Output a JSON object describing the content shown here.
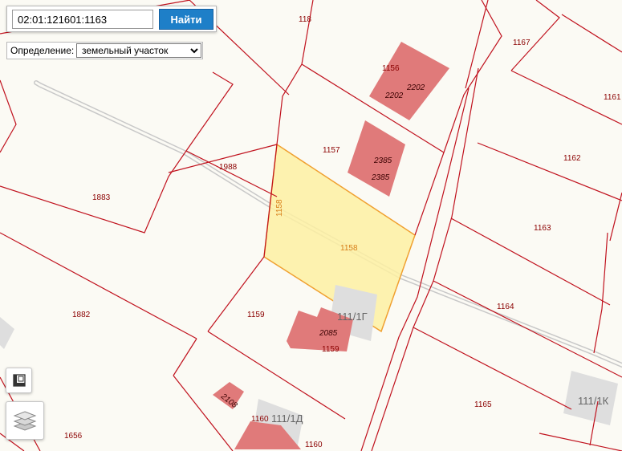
{
  "search": {
    "value": "02:01:121601:1163",
    "button_label": "Найти"
  },
  "definition": {
    "label": "Определение:",
    "selected": "земельный участок"
  },
  "map": {
    "watermark_text": "",
    "parcels": {
      "p118": "118",
      "p1167": "1167",
      "p1161": "1161",
      "p1156": "1156",
      "p1157": "1157",
      "p1162": "1162",
      "p1988": "1988",
      "p1883": "1883",
      "p1158_vertical": "1158",
      "p1158": "1158",
      "p1163": "1163",
      "p1164": "1164",
      "p1882": "1882",
      "p1159_a": "1159",
      "p1159_b": "1159",
      "p1165": "1165",
      "p1160_a": "1160",
      "p1160_b": "1160",
      "p1656": "1656"
    },
    "buildings": {
      "b2202_a": "2202",
      "b2202_b": "2202",
      "b2385_a": "2385",
      "b2385_b": "2385",
      "b2085": "2085",
      "b2108": "2108"
    },
    "addresses": {
      "a111_1g": "111/1Г",
      "a111_1d": "111/1Д",
      "a111_1k": "111/1К"
    },
    "colors": {
      "boundary": "#c0111d",
      "selected_fill": "#fdf0a2",
      "selected_stroke": "#f0a030",
      "building": "#e07a7a",
      "road": "#bdbdbd"
    }
  },
  "controls": {
    "legend_icon": "legend-icon",
    "layers_icon": "layers-icon"
  }
}
